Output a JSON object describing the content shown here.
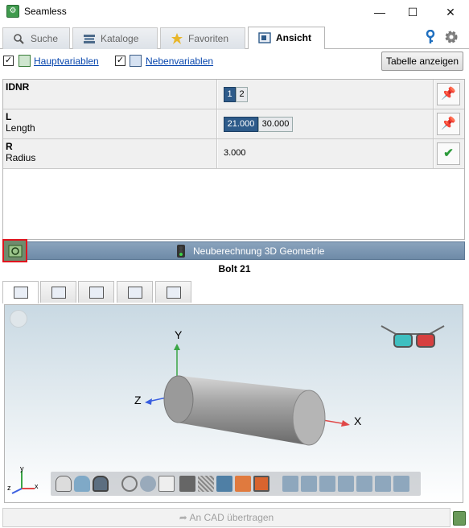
{
  "window": {
    "title": "Seamless",
    "minimize": "—",
    "maximize": "☐",
    "close": "✕"
  },
  "tabs": [
    {
      "label": "Suche",
      "icon": "search-icon"
    },
    {
      "label": "Kataloge",
      "icon": "books-icon"
    },
    {
      "label": "Favoriten",
      "icon": "star-icon"
    },
    {
      "label": "Ansicht",
      "icon": "view-icon",
      "active": true
    }
  ],
  "options": {
    "main_vars": {
      "label": "Hauptvariablen",
      "checked": true
    },
    "side_vars": {
      "label": "Nebenvariablen",
      "checked": true
    },
    "table_button": "Tabelle anzeigen"
  },
  "variables": [
    {
      "name": "IDNR",
      "desc": "",
      "values": [
        "1",
        "2"
      ],
      "selected": "1",
      "action": "pin-icon"
    },
    {
      "name": "L",
      "desc": "Length",
      "values": [
        "21.000",
        "30.000"
      ],
      "selected": "21.000",
      "action": "pin-icon"
    },
    {
      "name": "R",
      "desc": "Radius",
      "value": "3.000",
      "action": "check-icon"
    }
  ],
  "recalc": {
    "label": "Neuberechnung 3D Geometrie"
  },
  "part_title": "Bolt 21",
  "viewport": {
    "axis_x": "X",
    "axis_y": "Y",
    "axis_z": "Z",
    "mini_x": "x",
    "mini_y": "y",
    "mini_z": "z"
  },
  "cad_button": "An CAD übertragen",
  "colors": {
    "accent": "#2e5b8a",
    "recalc_bar": "#7f98b3",
    "highlight_red": "#e0141e"
  }
}
